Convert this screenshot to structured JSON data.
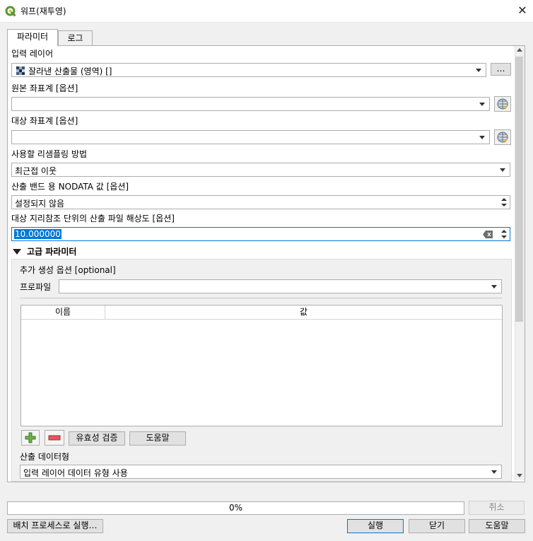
{
  "window": {
    "title": "워프(재투영)",
    "close_glyph": "✕"
  },
  "tabs": [
    {
      "label": "파라미터"
    },
    {
      "label": "로그"
    }
  ],
  "params": {
    "input_layer": {
      "label": "입력 레이어",
      "value": "잘라낸 산출물 (영역) []",
      "more": "…"
    },
    "source_crs": {
      "label": "원본 좌표계 [옵션]",
      "value": ""
    },
    "target_crs": {
      "label": "대상 좌표계 [옵션]",
      "value": ""
    },
    "resampling": {
      "label": "사용할 리샘플링 방법",
      "value": "최근접 이웃"
    },
    "nodata": {
      "label": "산출 밴드 용 NODATA 값 [옵션]",
      "value": "설정되지 않음"
    },
    "resolution": {
      "label": "대상 지리참조 단위의 산출 파일 해상도 [옵션]",
      "value": "10.000000"
    },
    "advanced": {
      "header": "고급 파라미터",
      "creation_options": "추가 생성 옵션 [optional]",
      "profile_label": "프로파일",
      "profile_value": "",
      "table_headers": [
        "이름",
        "값"
      ],
      "buttons": {
        "validate": "유효성 검증",
        "help": "도움말"
      },
      "output_type_label": "산출 데이터형",
      "output_type_value": "입력 레이어 데이터 유형 사용"
    }
  },
  "footer": {
    "progress_text": "0%",
    "progress": 0,
    "cancel": "취소",
    "batch": "배치 프로세스로 실행…",
    "run": "실행",
    "close": "닫기",
    "help": "도움말"
  },
  "icons": {
    "app": "qgis-logo-icon",
    "crs": "globe-crs-icon",
    "add": "plus-icon",
    "remove": "minus-icon",
    "clear": "clear-backspace-icon"
  },
  "colors": {
    "accent": "#0078d7",
    "qgis_green": "#589632",
    "remove_red": "#d9383a"
  }
}
